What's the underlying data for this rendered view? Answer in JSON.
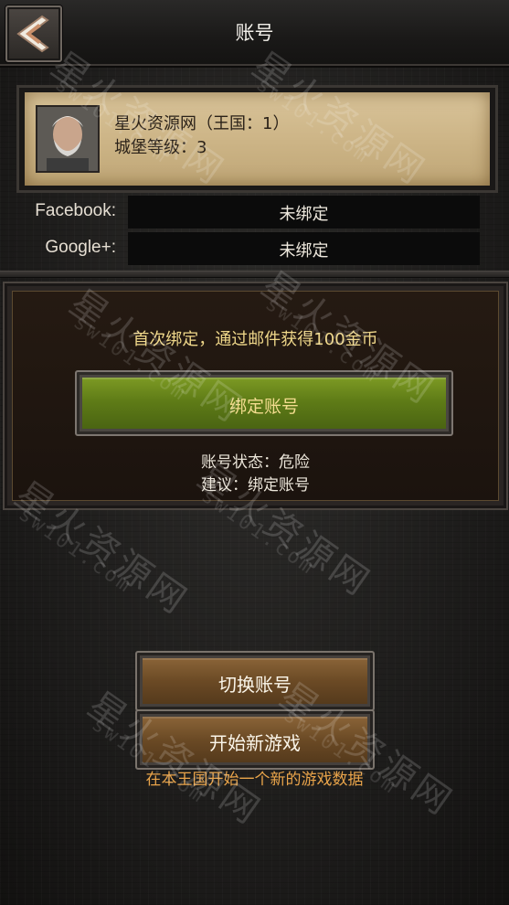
{
  "header": {
    "title": "账号",
    "back_icon": "back-arrow-icon"
  },
  "profile": {
    "name_line": "星火资源网（王国：1）",
    "level_line": "城堡等级：3"
  },
  "bindings": [
    {
      "label": "Facebook:",
      "value": "未绑定"
    },
    {
      "label": "Google+:",
      "value": "未绑定"
    }
  ],
  "bind_panel": {
    "hint": "首次绑定，通过邮件获得100金币",
    "bind_button": "绑定账号",
    "status": "账号状态：危险",
    "advice": "建议：绑定账号"
  },
  "actions": {
    "switch_account": "切换账号",
    "new_game": "开始新游戏",
    "new_game_desc": "在本王国开始一个新的游戏数据"
  },
  "watermark": {
    "text": "星火资源网",
    "url": "sw101.com"
  },
  "colors": {
    "hint_gold": "#f0d88a",
    "warning_orange": "#e9a44a",
    "green_button": "#5f7c17",
    "brown_button": "#6b4a25",
    "parchment": "#cdb587"
  }
}
